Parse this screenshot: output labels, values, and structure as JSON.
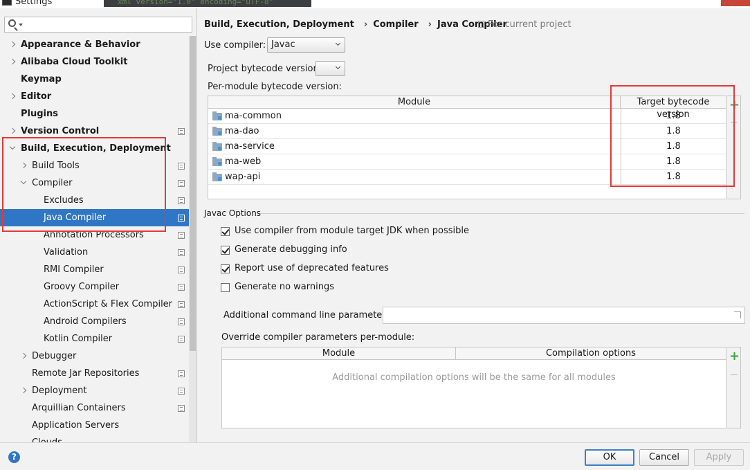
{
  "window": {
    "title": "Settings",
    "code_snippet": "xml version=\"1.0\" encoding=\"UTF-8\""
  },
  "sidebar": {
    "search": {
      "value": "",
      "placeholder": ""
    },
    "items": [
      {
        "label": "Appearance & Behavior",
        "bold": true,
        "level": 0,
        "arrow": "right",
        "proj": false
      },
      {
        "label": "Alibaba Cloud Toolkit",
        "bold": true,
        "level": 0,
        "arrow": "right",
        "proj": false
      },
      {
        "label": "Keymap",
        "bold": true,
        "level": 0,
        "arrow": "none",
        "proj": false
      },
      {
        "label": "Editor",
        "bold": true,
        "level": 0,
        "arrow": "right",
        "proj": false
      },
      {
        "label": "Plugins",
        "bold": true,
        "level": 0,
        "arrow": "none",
        "proj": false
      },
      {
        "label": "Version Control",
        "bold": true,
        "level": 0,
        "arrow": "right",
        "proj": true
      },
      {
        "label": "Build, Execution, Deployment",
        "bold": true,
        "level": 0,
        "arrow": "down",
        "proj": false
      },
      {
        "label": "Build Tools",
        "bold": false,
        "level": 1,
        "arrow": "right",
        "proj": true
      },
      {
        "label": "Compiler",
        "bold": false,
        "level": 1,
        "arrow": "down",
        "proj": true
      },
      {
        "label": "Excludes",
        "bold": false,
        "level": 2,
        "arrow": "none",
        "proj": true
      },
      {
        "label": "Java Compiler",
        "bold": false,
        "level": 2,
        "arrow": "none",
        "proj": true,
        "selected": true
      },
      {
        "label": "Annotation Processors",
        "bold": false,
        "level": 2,
        "arrow": "none",
        "proj": true
      },
      {
        "label": "Validation",
        "bold": false,
        "level": 2,
        "arrow": "none",
        "proj": true
      },
      {
        "label": "RMI Compiler",
        "bold": false,
        "level": 2,
        "arrow": "none",
        "proj": true
      },
      {
        "label": "Groovy Compiler",
        "bold": false,
        "level": 2,
        "arrow": "none",
        "proj": true
      },
      {
        "label": "ActionScript & Flex Compiler",
        "bold": false,
        "level": 2,
        "arrow": "none",
        "proj": true
      },
      {
        "label": "Android Compilers",
        "bold": false,
        "level": 2,
        "arrow": "none",
        "proj": true
      },
      {
        "label": "Kotlin Compiler",
        "bold": false,
        "level": 2,
        "arrow": "none",
        "proj": true
      },
      {
        "label": "Debugger",
        "bold": false,
        "level": 1,
        "arrow": "right",
        "proj": false
      },
      {
        "label": "Remote Jar Repositories",
        "bold": false,
        "level": 1,
        "arrow": "none",
        "proj": true
      },
      {
        "label": "Deployment",
        "bold": false,
        "level": 1,
        "arrow": "right",
        "proj": true
      },
      {
        "label": "Arquillian Containers",
        "bold": false,
        "level": 1,
        "arrow": "none",
        "proj": true
      },
      {
        "label": "Application Servers",
        "bold": false,
        "level": 1,
        "arrow": "none",
        "proj": false
      },
      {
        "label": "Clouds",
        "bold": false,
        "level": 1,
        "arrow": "none",
        "proj": false
      }
    ]
  },
  "breadcrumb": [
    "Build, Execution, Deployment",
    "Compiler",
    "Java Compiler"
  ],
  "breadcrumb_sep": "›",
  "for_current_project": "For current project",
  "use_compiler": {
    "label": "Use compiler:",
    "value": "Javac"
  },
  "project_bytecode": {
    "label": "Project bytecode version:",
    "value": ""
  },
  "per_module": {
    "label": "Per-module bytecode version:",
    "headers": [
      "Module",
      "Target bytecode version"
    ],
    "rows": [
      {
        "module": "ma-common",
        "version": "1.8"
      },
      {
        "module": "ma-dao",
        "version": "1.8"
      },
      {
        "module": "ma-service",
        "version": "1.8"
      },
      {
        "module": "ma-web",
        "version": "1.8"
      },
      {
        "module": "wap-api",
        "version": "1.8"
      }
    ]
  },
  "javac_options": {
    "group_label": "Javac Options",
    "checkboxes": [
      {
        "label": "Use compiler from module target JDK when possible",
        "checked": true
      },
      {
        "label": "Generate debugging info",
        "checked": true
      },
      {
        "label": "Report use of deprecated features",
        "checked": true
      },
      {
        "label": "Generate no warnings",
        "checked": false
      }
    ],
    "additional_params": {
      "label": "Additional command line parameters:",
      "value": ""
    },
    "override": {
      "label": "Override compiler parameters per-module:",
      "headers": [
        "Module",
        "Compilation options"
      ],
      "empty_text": "Additional compilation options will be the same for all modules"
    }
  },
  "tool_icons": {
    "add": "+",
    "remove": "−"
  },
  "footer": {
    "help": "?",
    "ok": "OK",
    "cancel": "Cancel",
    "apply": "Apply"
  },
  "colors": {
    "selection": "#2f77c5",
    "highlight_box": "#e53935",
    "add_green": "#3aa541"
  }
}
